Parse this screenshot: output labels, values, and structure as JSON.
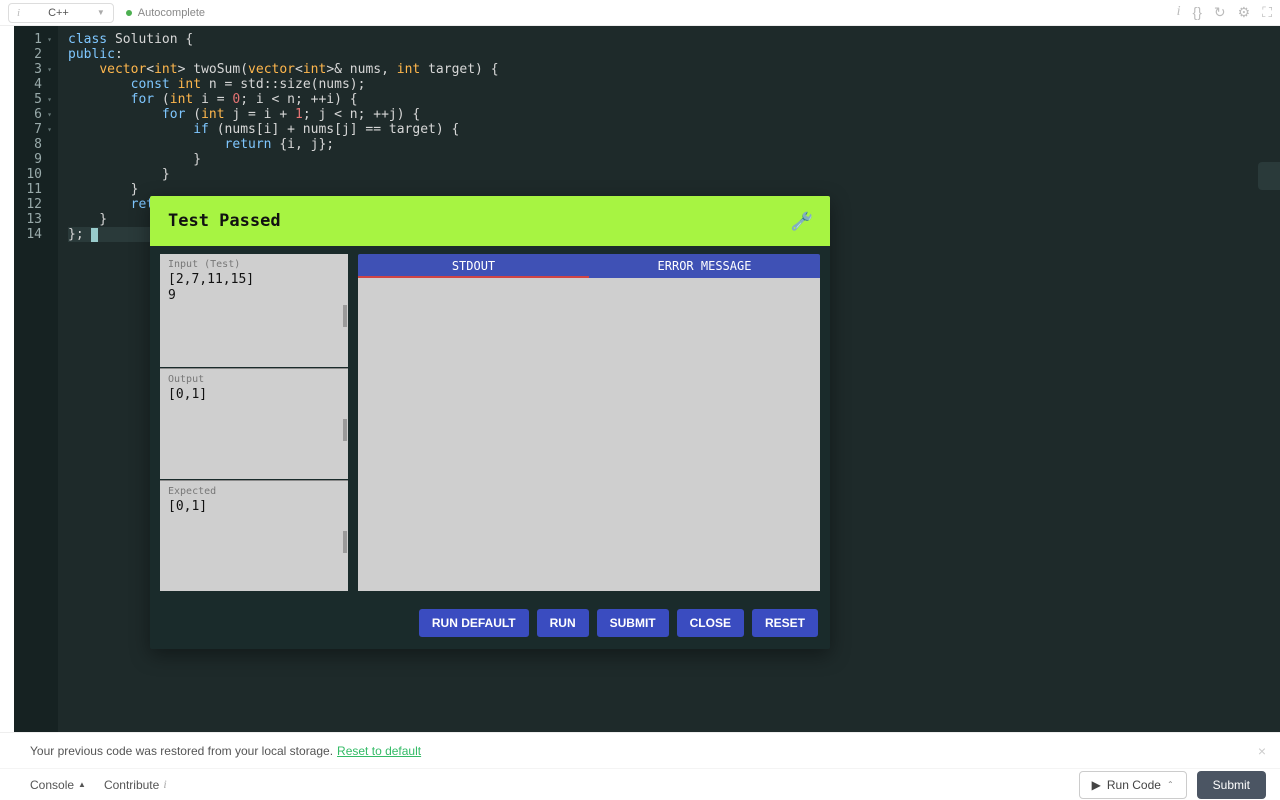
{
  "toolbar": {
    "language": "C++",
    "autocomplete": "Autocomplete"
  },
  "code": {
    "lines": [
      "class Solution {",
      "public:",
      "    vector<int> twoSum(vector<int>& nums, int target) {",
      "        const int n = std::size(nums);",
      "        for (int i = 0; i < n; ++i) {",
      "            for (int j = i + 1; j < n; ++j) {",
      "                if (nums[i] + nums[j] == target) {",
      "                    return {i, j};",
      "                }",
      "            }",
      "        }",
      "        return {};",
      "    }",
      "};"
    ],
    "fold_lines": [
      1,
      3,
      5,
      6,
      7
    ]
  },
  "dialog": {
    "title": "Test Passed",
    "panels": {
      "input_label": "Input (Test)",
      "input_value": "[2,7,11,15]\n9",
      "output_label": "Output",
      "output_value": "[0,1]",
      "expected_label": "Expected",
      "expected_value": "[0,1]"
    },
    "tabs": {
      "stdout": "STDOUT",
      "error": "ERROR MESSAGE"
    },
    "buttons": {
      "run_default": "RUN DEFAULT",
      "run": "RUN",
      "submit": "SUBMIT",
      "close": "CLOSE",
      "reset": "RESET"
    }
  },
  "notice": {
    "text": "Your previous code was restored from your local storage.",
    "link": "Reset to default"
  },
  "footer": {
    "console": "Console",
    "contribute": "Contribute",
    "run_code": "Run Code",
    "submit": "Submit"
  }
}
